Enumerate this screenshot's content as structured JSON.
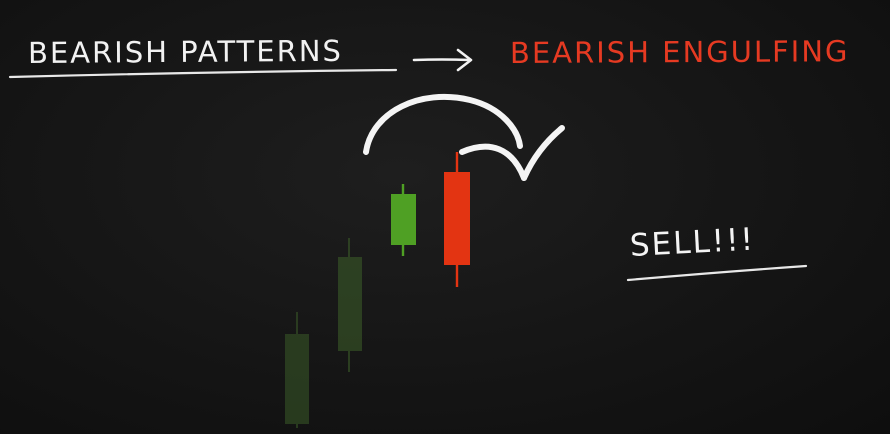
{
  "heading": {
    "left_text": "BEARISH  PATTERNS",
    "right_text": "BEARISH ENGULFING"
  },
  "callout": {
    "text": "SELL!!!"
  },
  "candles": [
    {
      "direction": "bullish",
      "color": "#3a5a28",
      "opacity": 0.55
    },
    {
      "direction": "bullish",
      "color": "#3a5a28",
      "opacity": 0.6
    },
    {
      "direction": "bullish",
      "color": "#4fa024",
      "opacity": 1
    },
    {
      "direction": "bearish",
      "color": "#e33412",
      "opacity": 1
    }
  ],
  "colors": {
    "background": "#151515",
    "chalk": "#f2f2f2",
    "accent_red": "#e63a22",
    "bull_green": "#4fa024"
  },
  "icons": {
    "heading_arrow": "right-arrow-icon",
    "curved_arrow": "curved-arrow-icon"
  }
}
